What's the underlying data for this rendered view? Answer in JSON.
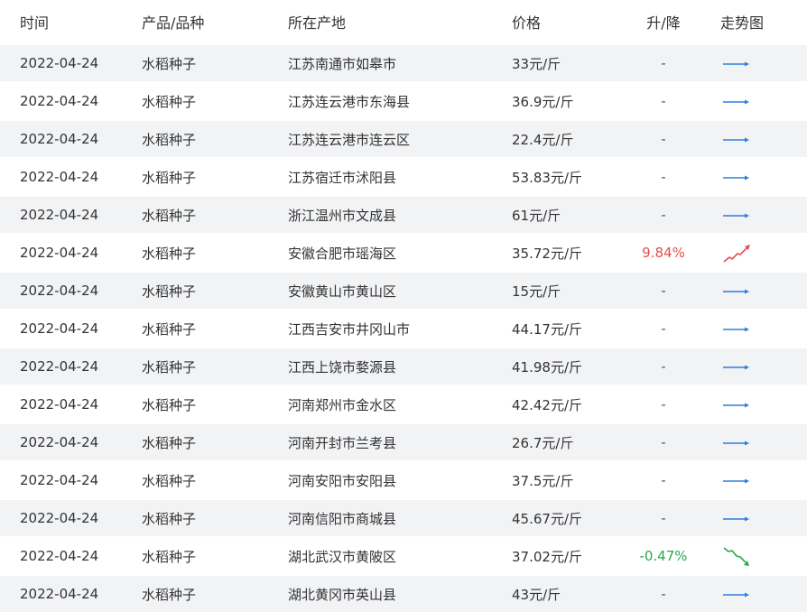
{
  "headers": {
    "date": "时间",
    "product": "产品/品种",
    "origin": "所在产地",
    "price": "价格",
    "change": "升/降",
    "trend": "走势图"
  },
  "colors": {
    "up": "#e94b4b",
    "down": "#2aa84a",
    "flat": "#2b7fe0",
    "stripe": "#f2f3f5"
  },
  "rows": [
    {
      "date": "2022-04-24",
      "product": "水稻种子",
      "origin": "江苏南通市如皋市",
      "price": "33元/斤",
      "change": "-",
      "trend": "flat"
    },
    {
      "date": "2022-04-24",
      "product": "水稻种子",
      "origin": "江苏连云港市东海县",
      "price": "36.9元/斤",
      "change": "-",
      "trend": "flat"
    },
    {
      "date": "2022-04-24",
      "product": "水稻种子",
      "origin": "江苏连云港市连云区",
      "price": "22.4元/斤",
      "change": "-",
      "trend": "flat"
    },
    {
      "date": "2022-04-24",
      "product": "水稻种子",
      "origin": "江苏宿迁市沭阳县",
      "price": "53.83元/斤",
      "change": "-",
      "trend": "flat"
    },
    {
      "date": "2022-04-24",
      "product": "水稻种子",
      "origin": "浙江温州市文成县",
      "price": "61元/斤",
      "change": "-",
      "trend": "flat"
    },
    {
      "date": "2022-04-24",
      "product": "水稻种子",
      "origin": "安徽合肥市瑶海区",
      "price": "35.72元/斤",
      "change": "9.84%",
      "trend": "up"
    },
    {
      "date": "2022-04-24",
      "product": "水稻种子",
      "origin": "安徽黄山市黄山区",
      "price": "15元/斤",
      "change": "-",
      "trend": "flat"
    },
    {
      "date": "2022-04-24",
      "product": "水稻种子",
      "origin": "江西吉安市井冈山市",
      "price": "44.17元/斤",
      "change": "-",
      "trend": "flat"
    },
    {
      "date": "2022-04-24",
      "product": "水稻种子",
      "origin": "江西上饶市婺源县",
      "price": "41.98元/斤",
      "change": "-",
      "trend": "flat"
    },
    {
      "date": "2022-04-24",
      "product": "水稻种子",
      "origin": "河南郑州市金水区",
      "price": "42.42元/斤",
      "change": "-",
      "trend": "flat"
    },
    {
      "date": "2022-04-24",
      "product": "水稻种子",
      "origin": "河南开封市兰考县",
      "price": "26.7元/斤",
      "change": "-",
      "trend": "flat"
    },
    {
      "date": "2022-04-24",
      "product": "水稻种子",
      "origin": "河南安阳市安阳县",
      "price": "37.5元/斤",
      "change": "-",
      "trend": "flat"
    },
    {
      "date": "2022-04-24",
      "product": "水稻种子",
      "origin": "河南信阳市商城县",
      "price": "45.67元/斤",
      "change": "-",
      "trend": "flat"
    },
    {
      "date": "2022-04-24",
      "product": "水稻种子",
      "origin": "湖北武汉市黄陂区",
      "price": "37.02元/斤",
      "change": "-0.47%",
      "trend": "down"
    },
    {
      "date": "2022-04-24",
      "product": "水稻种子",
      "origin": "湖北黄冈市英山县",
      "price": "43元/斤",
      "change": "-",
      "trend": "flat"
    }
  ]
}
